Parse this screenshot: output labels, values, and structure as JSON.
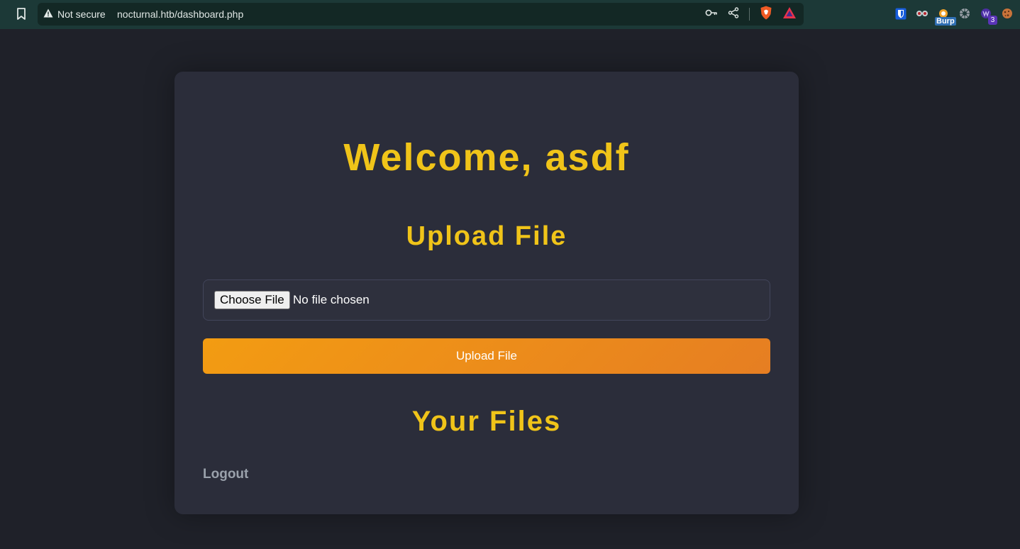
{
  "browser": {
    "security_label": "Not secure",
    "url": "nocturnal.htb/dashboard.php",
    "extensions": {
      "burp_label": "Burp",
      "badge_count": "3"
    }
  },
  "main": {
    "welcome": "Welcome, asdf",
    "upload_heading": "Upload File",
    "file_input": {
      "button_label": "Choose File",
      "status": "No file chosen"
    },
    "upload_button": "Upload File",
    "files_heading": "Your Files",
    "logout": "Logout"
  },
  "colors": {
    "accent_yellow": "#f0c419",
    "button_orange_start": "#f39c12",
    "button_orange_end": "#e67e22",
    "page_bg": "#1f2129",
    "card_bg": "#2b2d3a"
  },
  "icons": [
    "bookmark-icon",
    "warning-icon",
    "key-icon",
    "share-icon",
    "brave-shield-icon",
    "brave-rewards-icon",
    "bitwarden-icon",
    "extension-spy-icon",
    "burp-icon",
    "extension-gear-icon",
    "wappalyzer-icon",
    "cookie-icon"
  ]
}
